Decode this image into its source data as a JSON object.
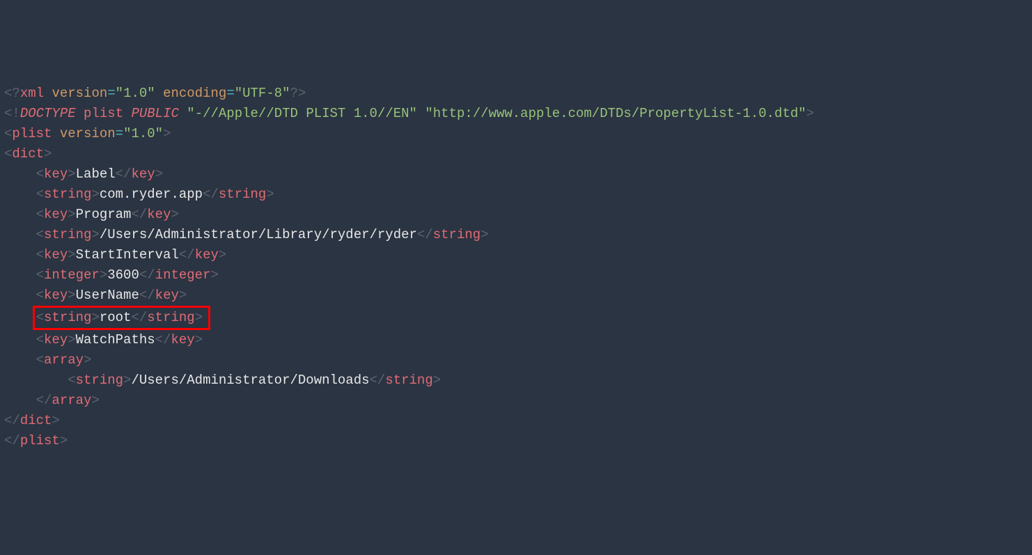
{
  "line1": {
    "open": "<?",
    "xml": "xml",
    "gap": " ",
    "attr1": "version",
    "eq1": "=",
    "val1": "\"1.0\"",
    "gap2": " ",
    "attr2": "encoding",
    "eq2": "=",
    "val2": "\"UTF-8\"",
    "close": "?>"
  },
  "line2": {
    "open": "<!",
    "doctype": "DOCTYPE",
    "sp1": " ",
    "root": "plist",
    "sp2": " ",
    "pub": "PUBLIC",
    "sp3": " ",
    "fpi": "\"-//Apple//DTD PLIST 1.0//EN\"",
    "sp4": " ",
    "uri": "\"http://www.apple.com/DTDs/PropertyList-1.0.dtd\"",
    "close": ">"
  },
  "line3": {
    "open": "<",
    "tag": "plist",
    "sp": " ",
    "attr": "version",
    "eq": "=",
    "val": "\"1.0\"",
    "close": ">"
  },
  "line4": {
    "open": "<",
    "tag": "dict",
    "close": ">"
  },
  "line5": {
    "indent": "    ",
    "o": "<",
    "tag1": "key",
    "c": ">",
    "txt": "Label",
    "o2": "</",
    "tag2": "key",
    "c2": ">"
  },
  "line6": {
    "indent": "    ",
    "o": "<",
    "tag1": "string",
    "c": ">",
    "txt": "com.ryder.app",
    "o2": "</",
    "tag2": "string",
    "c2": ">"
  },
  "line7": {
    "indent": "    ",
    "o": "<",
    "tag1": "key",
    "c": ">",
    "txt": "Program",
    "o2": "</",
    "tag2": "key",
    "c2": ">"
  },
  "line8": {
    "indent": "    ",
    "o": "<",
    "tag1": "string",
    "c": ">",
    "txt": "/Users/Administrator/Library/ryder/ryder",
    "o2": "</",
    "tag2": "string",
    "c2": ">"
  },
  "line9": {
    "indent": "    ",
    "o": "<",
    "tag1": "key",
    "c": ">",
    "txt": "StartInterval",
    "o2": "</",
    "tag2": "key",
    "c2": ">"
  },
  "line10": {
    "indent": "    ",
    "o": "<",
    "tag1": "integer",
    "c": ">",
    "txt": "3600",
    "o2": "</",
    "tag2": "integer",
    "c2": ">"
  },
  "line11": {
    "indent": "    ",
    "o": "<",
    "tag1": "key",
    "c": ">",
    "txt": "UserName",
    "o2": "</",
    "tag2": "key",
    "c2": ">"
  },
  "line12": {
    "indent": "    ",
    "o": "<",
    "tag1": "string",
    "c": ">",
    "txt": "root",
    "o2": "</",
    "tag2": "string",
    "c2": ">"
  },
  "line13": {
    "indent": "    ",
    "o": "<",
    "tag1": "key",
    "c": ">",
    "txt": "WatchPaths",
    "o2": "</",
    "tag2": "key",
    "c2": ">"
  },
  "line14": {
    "indent": "    ",
    "o": "<",
    "tag": "array",
    "c": ">"
  },
  "line15": {
    "indent": "        ",
    "o": "<",
    "tag1": "string",
    "c": ">",
    "txt": "/Users/Administrator/Downloads",
    "o2": "</",
    "tag2": "string",
    "c2": ">"
  },
  "line16": {
    "indent": "    ",
    "o": "</",
    "tag": "array",
    "c": ">"
  },
  "line17": {
    "o": "</",
    "tag": "dict",
    "c": ">"
  },
  "line18": {
    "o": "</",
    "tag": "plist",
    "c": ">"
  }
}
